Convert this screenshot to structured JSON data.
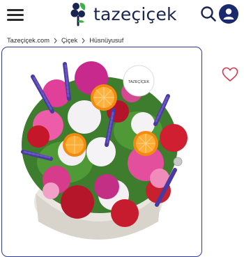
{
  "header": {
    "brand": "tazeçiçek",
    "icons": {
      "menu": "menu-icon",
      "logo": "flower-logo-icon",
      "search": "search-icon",
      "profile": "user-icon"
    },
    "colors": {
      "brand_navy": "#1a2450",
      "logo_leaf": "#3bb14a",
      "profile_bg": "#1a2a6c"
    }
  },
  "breadcrumb": {
    "items": [
      "Tazeçiçek.com",
      "Çiçek",
      "Hüsnüyusuf"
    ]
  },
  "product": {
    "image_tag_brand": "TAZEÇİÇEK",
    "favorite_icon": "heart-icon",
    "colors": {
      "frame_border": "#2e3b96",
      "favorite": "#d9364f"
    }
  }
}
